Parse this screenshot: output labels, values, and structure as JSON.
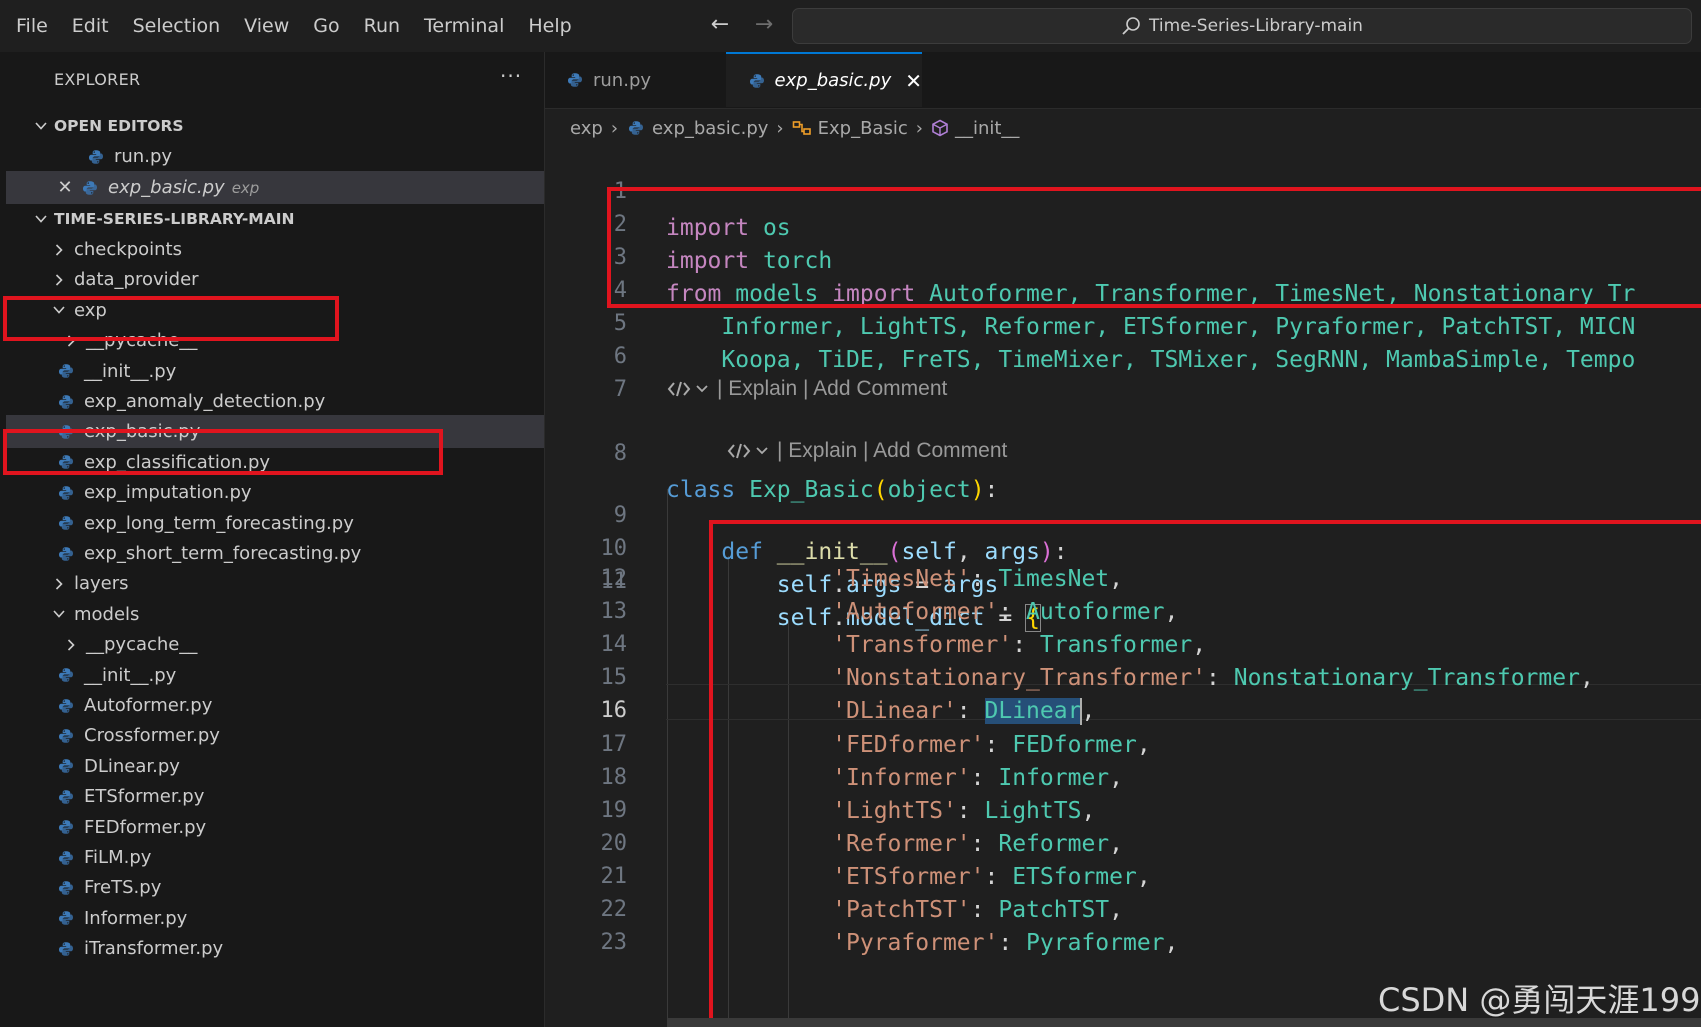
{
  "menu": {
    "items": [
      "File",
      "Edit",
      "Selection",
      "View",
      "Go",
      "Run",
      "Terminal",
      "Help"
    ]
  },
  "search": {
    "label": "Time-Series-Library-main"
  },
  "explorer": {
    "title": "EXPLORER",
    "more": "···",
    "open_editors_label": "OPEN EDITORS",
    "open_editors": [
      {
        "name": "run.py"
      },
      {
        "name": "exp_basic.py",
        "desc": "exp"
      }
    ],
    "root_label": "TIME-SERIES-LIBRARY-MAIN",
    "tree": [
      {
        "name": "checkpoints"
      },
      {
        "name": "data_provider"
      },
      {
        "name": "exp"
      },
      {
        "name": "__pycache__"
      },
      {
        "name": "__init__.py"
      },
      {
        "name": "exp_anomaly_detection.py"
      },
      {
        "name": "exp_basic.py"
      },
      {
        "name": "exp_classification.py"
      },
      {
        "name": "exp_imputation.py"
      },
      {
        "name": "exp_long_term_forecasting.py"
      },
      {
        "name": "exp_short_term_forecasting.py"
      },
      {
        "name": "layers"
      },
      {
        "name": "models"
      },
      {
        "name": "__pycache__"
      },
      {
        "name": "__init__.py"
      },
      {
        "name": "Autoformer.py"
      },
      {
        "name": "Crossformer.py"
      },
      {
        "name": "DLinear.py"
      },
      {
        "name": "ETSformer.py"
      },
      {
        "name": "FEDformer.py"
      },
      {
        "name": "FiLM.py"
      },
      {
        "name": "FreTS.py"
      },
      {
        "name": "Informer.py"
      },
      {
        "name": "iTransformer.py"
      }
    ]
  },
  "tabs": [
    {
      "name": "run.py"
    },
    {
      "name": "exp_basic.py"
    }
  ],
  "breadcrumb": [
    "exp",
    "exp_basic.py",
    "Exp_Basic",
    "__init__"
  ],
  "codelens": "| Explain | Add Comment",
  "code": {
    "l1": {
      "ln": "1",
      "a": "import",
      "b": " os"
    },
    "l2": {
      "ln": "2",
      "a": "import",
      "b": " torch"
    },
    "l3": {
      "ln": "3",
      "a": "from",
      "b": " models ",
      "c": "import",
      "d": " Autoformer, Transformer, TimesNet, Nonstationary_Tr"
    },
    "l4": {
      "ln": "4",
      "text": "    Informer, LightTS, Reformer, ETSformer, Pyraformer, PatchTST, MICN"
    },
    "l5": {
      "ln": "5",
      "text": "    Koopa, TiDE, FreTS, TimeMixer, TSMixer, SegRNN, MambaSimple, Tempo"
    },
    "l6": {
      "ln": "6"
    },
    "l7": {
      "ln": "7"
    },
    "l8": {
      "ln": "8",
      "kw": "class",
      "name": "Exp_Basic",
      "p1": "(",
      "base": "object",
      "p2": ")",
      "colon": ":"
    },
    "l9": {
      "ln": "9",
      "kw": "def",
      "name": "__init__",
      "p1": "(",
      "a1": "self",
      "comma": ", ",
      "a2": "args",
      "p2": ")",
      "colon": ":"
    },
    "l10": {
      "ln": "10",
      "a": "self",
      "b": ".",
      "c": "args",
      "d": " = ",
      "e": "args"
    },
    "l11": {
      "ln": "11",
      "a": "self",
      "b": ".",
      "c": "model_dict",
      "d": " = ",
      "e": "{"
    },
    "entries": [
      {
        "ln": "12",
        "key": "'TimesNet'",
        "val": "TimesNet"
      },
      {
        "ln": "13",
        "key": "'Autoformer'",
        "val": "Autoformer"
      },
      {
        "ln": "14",
        "key": "'Transformer'",
        "val": "Transformer"
      },
      {
        "ln": "15",
        "key": "'Nonstationary_Transformer'",
        "val": "Nonstationary_Transformer"
      },
      {
        "ln": "16",
        "key": "'DLinear'",
        "val": "DLinear"
      },
      {
        "ln": "17",
        "key": "'FEDformer'",
        "val": "FEDformer"
      },
      {
        "ln": "18",
        "key": "'Informer'",
        "val": "Informer"
      },
      {
        "ln": "19",
        "key": "'LightTS'",
        "val": "LightTS"
      },
      {
        "ln": "20",
        "key": "'Reformer'",
        "val": "Reformer"
      },
      {
        "ln": "21",
        "key": "'ETSformer'",
        "val": "ETSformer"
      },
      {
        "ln": "22",
        "key": "'PatchTST'",
        "val": "PatchTST"
      },
      {
        "ln": "23",
        "key": "'Pyraformer'",
        "val": "Pyraformer"
      }
    ]
  },
  "colors": {
    "highlight_box": "#e0141e",
    "accent": "#0078d4",
    "python_icon": "#3d7ab8"
  },
  "watermark": "CSDN @勇闯天涯199"
}
